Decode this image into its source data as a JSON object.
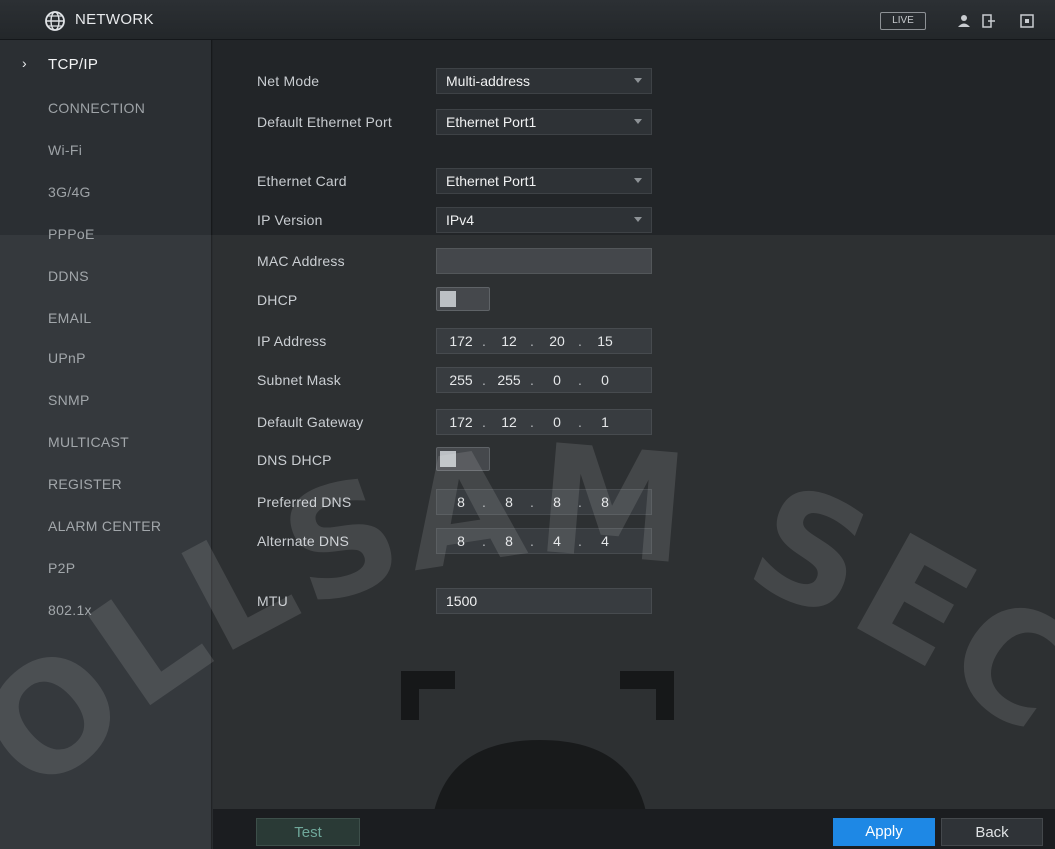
{
  "header": {
    "title": "NETWORK",
    "live_label": "LIVE"
  },
  "sidebar": {
    "items": [
      {
        "label": "TCP/IP",
        "active": true
      },
      {
        "label": "CONNECTION"
      },
      {
        "label": "Wi-Fi"
      },
      {
        "label": "3G/4G"
      },
      {
        "label": "PPPoE"
      },
      {
        "label": "DDNS"
      },
      {
        "label": "EMAIL"
      },
      {
        "label": "UPnP"
      },
      {
        "label": "SNMP"
      },
      {
        "label": "MULTICAST"
      },
      {
        "label": "REGISTER"
      },
      {
        "label": "ALARM CENTER"
      },
      {
        "label": "P2P"
      },
      {
        "label": "802.1x"
      }
    ]
  },
  "form": {
    "net_mode": {
      "label": "Net Mode",
      "value": "Multi-address"
    },
    "default_port": {
      "label": "Default Ethernet Port",
      "value": "Ethernet Port1"
    },
    "ethernet_card": {
      "label": "Ethernet Card",
      "value": "Ethernet Port1"
    },
    "ip_version": {
      "label": "IP Version",
      "value": "IPv4"
    },
    "mac": {
      "label": "MAC Address",
      "value": ""
    },
    "dhcp": {
      "label": "DHCP",
      "enabled": false
    },
    "ip_address": {
      "label": "IP Address",
      "octets": [
        "172",
        "12",
        "20",
        "15"
      ]
    },
    "subnet": {
      "label": "Subnet Mask",
      "octets": [
        "255",
        "255",
        "0",
        "0"
      ]
    },
    "gateway": {
      "label": "Default Gateway",
      "octets": [
        "172",
        "12",
        "0",
        "1"
      ]
    },
    "dns_dhcp": {
      "label": "DNS DHCP",
      "enabled": false
    },
    "preferred_dns": {
      "label": "Preferred DNS",
      "octets": [
        "8",
        "8",
        "8",
        "8"
      ]
    },
    "alternate_dns": {
      "label": "Alternate DNS",
      "octets": [
        "8",
        "8",
        "4",
        "4"
      ]
    },
    "mtu": {
      "label": "MTU",
      "value": "1500"
    }
  },
  "footer": {
    "test_label": "Test",
    "apply_label": "Apply",
    "back_label": "Back"
  },
  "watermark": {
    "text": "OLLSAM SECURIT"
  },
  "colors": {
    "accent": "#1e88e5",
    "background": "#222528",
    "sidebar": "#2b2f33"
  },
  "icons": {
    "title": "network-globe-icon",
    "toolbar": [
      "user-icon",
      "logout-icon",
      "shutdown-icon"
    ]
  }
}
